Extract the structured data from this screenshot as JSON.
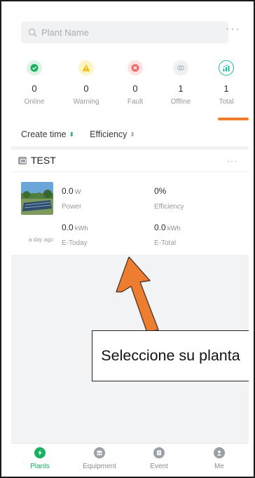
{
  "search": {
    "placeholder": "Plant Name"
  },
  "status": [
    {
      "count": "0",
      "label": "Online",
      "icon": "check-icon",
      "color": "#17b15f"
    },
    {
      "count": "0",
      "label": "Warning",
      "icon": "warning-icon",
      "color": "#f2b705"
    },
    {
      "count": "0",
      "label": "Fault",
      "icon": "fault-icon",
      "color": "#f26b6b"
    },
    {
      "count": "1",
      "label": "Offline",
      "icon": "offline-icon",
      "color": "#b7bcc2"
    },
    {
      "count": "1",
      "label": "Total",
      "icon": "total-chart-icon",
      "color": "#19b9a8",
      "selected": true
    }
  ],
  "sort": {
    "create_time": "Create time",
    "efficiency": "Efficiency"
  },
  "plant": {
    "name": "TEST",
    "power_value": "0.0",
    "power_unit": "W",
    "power_label": "Power",
    "efficiency_value": "0%",
    "efficiency_label": "Efficiency",
    "etoday_value": "0.0",
    "etoday_unit": "kWh",
    "etoday_label": "E-Today",
    "etotal_value": "0.0",
    "etotal_unit": "kWh",
    "etotal_label": "E-Total",
    "updated": "a day ago"
  },
  "annotation": {
    "text": "Seleccione su planta",
    "arrow_color": "#ed7d31"
  },
  "nav": [
    {
      "label": "Plants",
      "icon": "plant-bolt-icon",
      "active": true
    },
    {
      "label": "Equipment",
      "icon": "equipment-icon"
    },
    {
      "label": "Event",
      "icon": "event-icon"
    },
    {
      "label": "Me",
      "icon": "user-icon"
    }
  ],
  "colors": {
    "accent": "#17b15f",
    "tab_underline": "#f07b2d"
  }
}
